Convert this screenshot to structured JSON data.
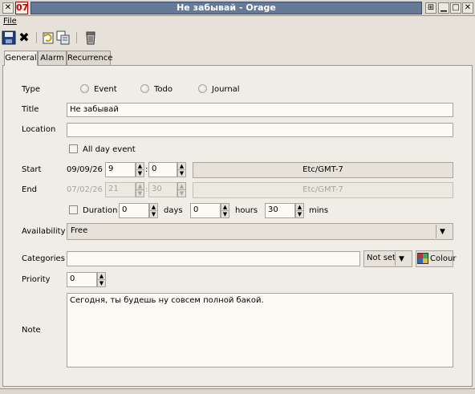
{
  "window": {
    "title": "Не забывай - Orage",
    "app_icon_text": "07",
    "close_glyph": "✕",
    "controls": [
      "⊞",
      "▁",
      "□",
      "✕"
    ]
  },
  "menu": {
    "file": "File"
  },
  "toolbar": {
    "icons": [
      "save-icon",
      "delete-icon",
      "revert-icon",
      "duplicate-icon",
      "trash-icon"
    ],
    "close_glyph": "✖"
  },
  "tabs": [
    {
      "label": "General",
      "active": true
    },
    {
      "label": "Alarm",
      "active": false
    },
    {
      "label": "Recurrence",
      "active": false
    }
  ],
  "form": {
    "type_label": "Type",
    "type_options": [
      "Event",
      "Todo",
      "Journal"
    ],
    "title_label": "Title",
    "title_value": "Не забывай",
    "location_label": "Location",
    "location_value": "",
    "all_day_label": "All day event",
    "start_label": "Start",
    "start_date": "09/09/26",
    "start_hour": "9",
    "start_minute": "0",
    "start_tz": "Etc/GMT-7",
    "end_label": "End",
    "end_date": "07/02/26",
    "end_hour": "21",
    "end_minute": "30",
    "end_tz": "Etc/GMT-7",
    "duration_label": "Duration",
    "duration_days": "0",
    "days_label": "days",
    "duration_hours": "0",
    "hours_label": "hours",
    "duration_mins": "30",
    "mins_label": "mins",
    "availability_label": "Availability",
    "availability_value": "Free",
    "categories_label": "Categories",
    "categories_value": "",
    "not_set": "Not set",
    "colour_label": "Colour",
    "priority_label": "Priority",
    "priority_value": "0",
    "note_label": "Note",
    "note_value": "Сегодня, ты будешь ну совсем полной бакой.",
    "time_separator": ":"
  },
  "glyphs": {
    "up": "▲",
    "down": "▼",
    "dropdown": "▼"
  },
  "colors": {
    "titlebar_active": "#657a97",
    "panel_bg": "#f0ede6",
    "window_bg": "#e6e2d9"
  }
}
